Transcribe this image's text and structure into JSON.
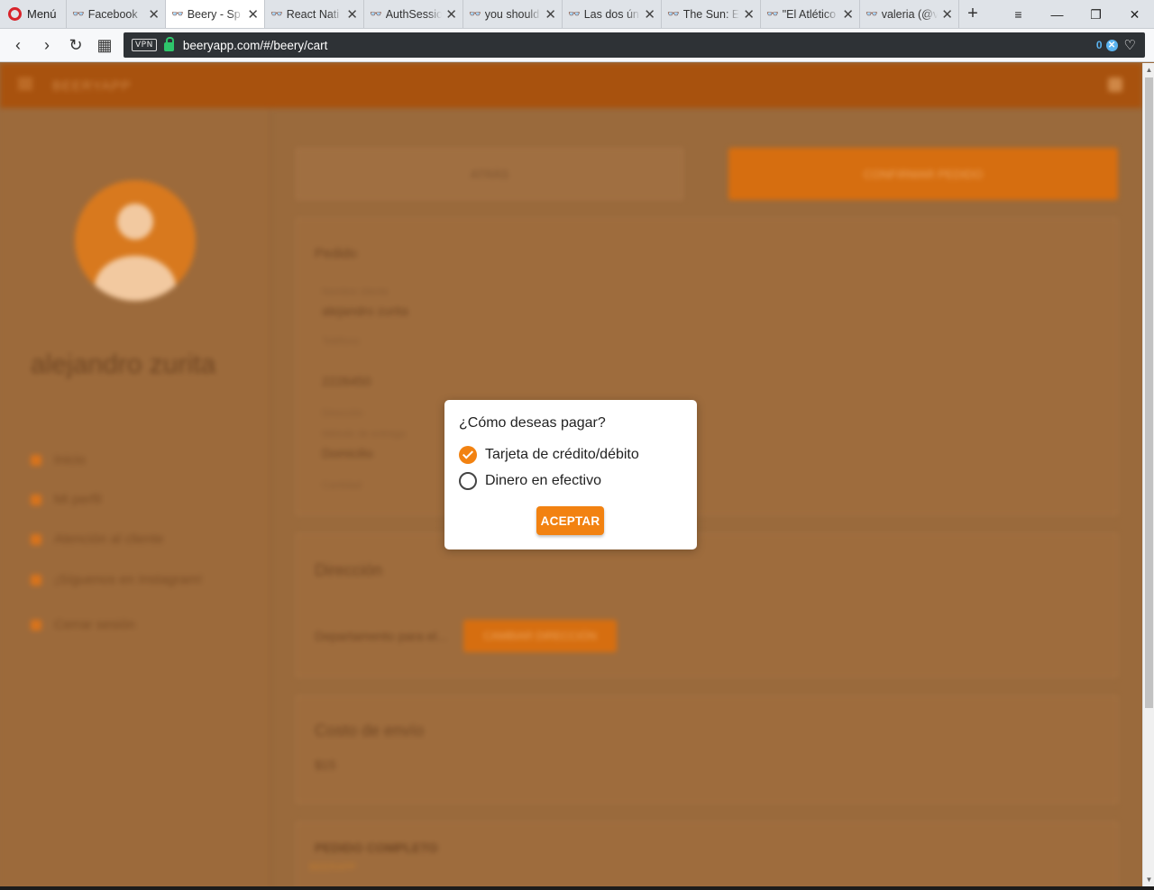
{
  "browser": {
    "menu_label": "Menú",
    "tabs": [
      {
        "label": "Facebook"
      },
      {
        "label": "Beery - Sp"
      },
      {
        "label": "React Nati"
      },
      {
        "label": "AuthSessio"
      },
      {
        "label": "you should"
      },
      {
        "label": "Las dos úni"
      },
      {
        "label": "The Sun: E"
      },
      {
        "label": "\"El Atlético"
      },
      {
        "label": "valeria (@v"
      }
    ],
    "active_tab_index": 1,
    "vpn_label": "VPN",
    "url": "beeryapp.com/#/beery/cart",
    "adblock_count": "0"
  },
  "app": {
    "title": "BEERYAPP",
    "username": "alejandro zurita",
    "sidebar_items": [
      {
        "label": "Inicio"
      },
      {
        "label": "Mi perfil"
      },
      {
        "label": "Atención al cliente"
      },
      {
        "label": "¡Síguenos en Instagram!"
      },
      {
        "label": "Cerrar sesión"
      }
    ],
    "back_button": "ATRÁS",
    "continue_button": "CONFIRMAR PEDIDO",
    "details_title": "Pedido",
    "fields": [
      {
        "label": "Nombre cliente",
        "value": "alejandro zurita"
      },
      {
        "label": "Teléfono",
        "value": ""
      },
      {
        "label": "",
        "value": "2226450"
      },
      {
        "label": "Dirección",
        "value": ""
      },
      {
        "label": "Método de entrega",
        "value": "Domicilio"
      },
      {
        "label": "Cantidad",
        "value": ""
      }
    ],
    "address_title": "Dirección",
    "address_prompt": "Departamento para el...",
    "change_button": "CAMBIAR DIRECCIÓN",
    "cost_title": "Costo de envío",
    "cost_value": "$15",
    "recent_title": "PEDIDO COMPLETO",
    "recent_sub": "BEERAPP"
  },
  "dialog": {
    "title": "¿Cómo deseas pagar?",
    "options": [
      {
        "label": "Tarjeta de crédito/débito",
        "selected": true
      },
      {
        "label": "Dinero en efectivo",
        "selected": false
      }
    ],
    "accept_label": "ACEPTAR"
  },
  "colors": {
    "accent": "#f28211",
    "overlay": "#9a6a3c",
    "url_bar": "#2e3236"
  }
}
